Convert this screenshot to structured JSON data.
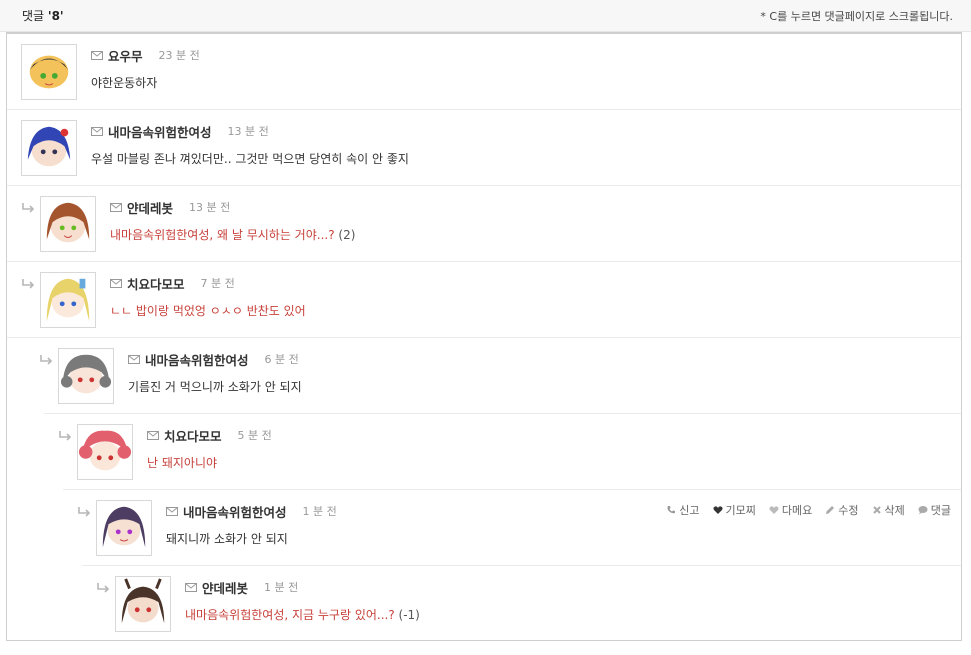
{
  "header": {
    "count_label": "댓글 ",
    "count_value": "'8'",
    "hint": "* C를 누르면 댓글페이지로 스크롤됩니다."
  },
  "comments": [
    {
      "author": "요우무",
      "time": "23 분 전",
      "text": "야한운동하자",
      "red": false,
      "score": "",
      "avatar_color": "#f4c25a",
      "hair": "#3b3b3b"
    },
    {
      "author": "내마음속위험한여성",
      "time": "13 분 전",
      "text": "우설 마블링 존나 껴있더만.. 그것만 먹으면 당연히 속이 안 좋지",
      "red": false,
      "score": "",
      "avatar_color": "#4a5fd1",
      "hair": "#3245b5"
    },
    {
      "author": "얀데레봇",
      "time": "13 분 전",
      "text": "내마음속위험한여성, 왜 날 무시하는 거야...?",
      "red": true,
      "score": " (2)",
      "avatar_color": "#b76a3e",
      "hair": "#a4552d"
    },
    {
      "author": "치요다모모",
      "time": "7 분 전",
      "text": "ㄴㄴ 밥이랑 먹었엉 ㅇㅅㅇ 반찬도 있어",
      "red": true,
      "score": "",
      "avatar_color": "#f3e38a",
      "hair": "#e8d36a"
    },
    {
      "author": "내마음속위험한여성",
      "time": "6 분 전",
      "text": "기름진 거 먹으니까 소화가 안 되지",
      "red": false,
      "score": "",
      "avatar_color": "#8d8d8d",
      "hair": "#7a7a7a"
    },
    {
      "author": "치요다모모",
      "time": "5 분 전",
      "text": "난 돼지아니야",
      "red": true,
      "score": "",
      "avatar_color": "#e77b86",
      "hair": "#e25f6e"
    },
    {
      "author": "내마음속위험한여성",
      "time": "1 분 전",
      "text": "돼지니까 소화가 안 되지",
      "red": false,
      "score": "",
      "avatar_color": "#5a4a6e",
      "hair": "#4d3d62"
    },
    {
      "author": "얀데레봇",
      "time": "1 분 전",
      "text": "내마음속위험한여성, 지금 누구랑 있어...?",
      "red": true,
      "score": " (-1)",
      "avatar_color": "#5a4236",
      "hair": "#4a3328"
    }
  ],
  "actions": {
    "report": "신고",
    "like": "기모찌",
    "dislike": "다메요",
    "edit": "수정",
    "delete": "삭제",
    "reply": "댓글"
  }
}
